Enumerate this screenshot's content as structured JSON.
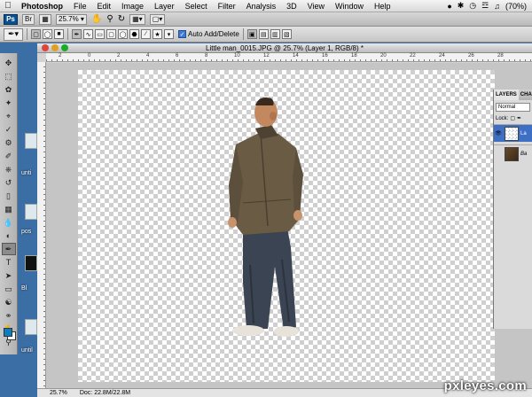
{
  "menubar": {
    "app": "Photoshop",
    "items": [
      "File",
      "Edit",
      "Image",
      "Layer",
      "Select",
      "Filter",
      "Analysis",
      "3D",
      "View",
      "Window",
      "Help"
    ],
    "battery": "(70%)"
  },
  "appbar": {
    "logo": "Ps",
    "zoom": "25.7%"
  },
  "options": {
    "auto_add_delete_label": "Auto Add/Delete",
    "auto_add_delete_checked": true
  },
  "desktop": {
    "labels": [
      "unti",
      "pos",
      "Bl",
      "until"
    ]
  },
  "document": {
    "title": "Little man_0015.JPG @ 25.7% (Layer 1, RGB/8) *",
    "ruler_marks": [
      "2",
      "0",
      "2",
      "4",
      "6",
      "8",
      "10",
      "12",
      "14",
      "16",
      "18",
      "20",
      "22",
      "24",
      "26",
      "28"
    ],
    "status_zoom": "25.7%",
    "status_doc": "Doc: 22.8M/22.8M"
  },
  "layers_panel": {
    "tabs": [
      "LAYERS",
      "CHA"
    ],
    "blend_mode": "Normal",
    "lock_label": "Lock:",
    "layers": [
      {
        "name": "La",
        "selected": true
      },
      {
        "name": "Ba",
        "selected": false
      }
    ]
  },
  "watermark": "pxleyes.com"
}
